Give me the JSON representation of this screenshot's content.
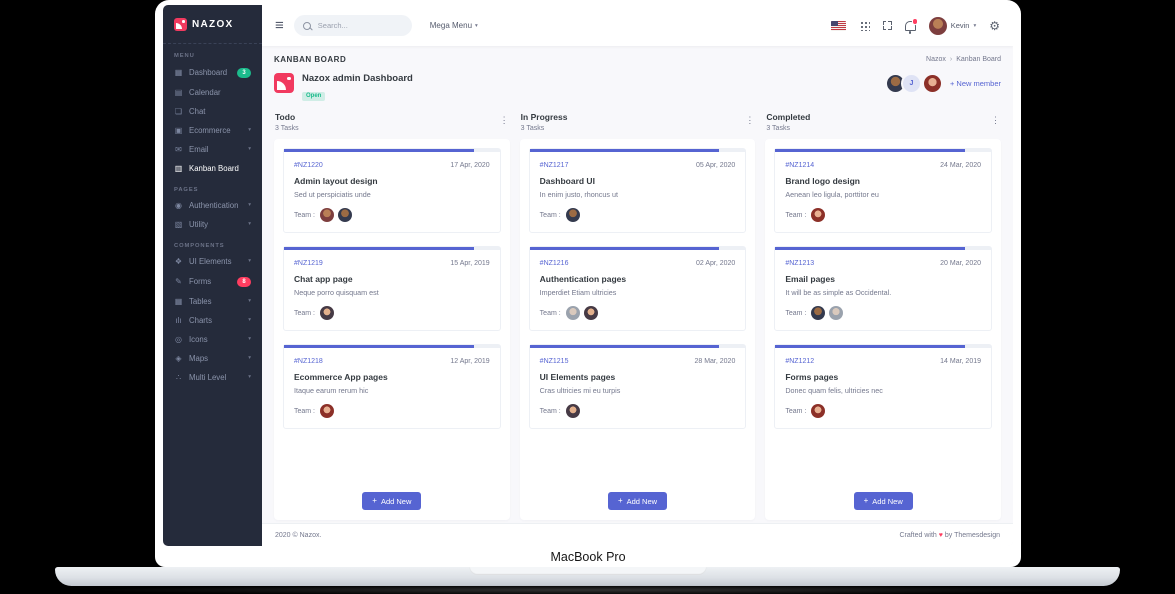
{
  "device": {
    "label": "MacBook Pro"
  },
  "brand": {
    "name": "NAZOX"
  },
  "colors": {
    "primary": "#5664d2",
    "success": "#1cbb8c",
    "danger": "#ff3d60",
    "sidebar_bg": "#252b3b",
    "body_bg": "#f8f8fb",
    "logo_red": "#f13a5f"
  },
  "topbar": {
    "search_placeholder": "Search...",
    "mega_menu_label": "Mega Menu",
    "user_name": "Kevin"
  },
  "sidebar": {
    "sections": [
      {
        "label": "MENU",
        "items": [
          {
            "label": "Dashboard",
            "badge": "3"
          },
          {
            "label": "Calendar"
          },
          {
            "label": "Chat"
          },
          {
            "label": "Ecommerce"
          },
          {
            "label": "Email"
          },
          {
            "label": "Kanban Board"
          }
        ]
      },
      {
        "label": "PAGES",
        "items": [
          {
            "label": "Authentication"
          },
          {
            "label": "Utility"
          }
        ]
      },
      {
        "label": "COMPONENTS",
        "items": [
          {
            "label": "UI Elements"
          },
          {
            "label": "Forms",
            "badge": "8"
          },
          {
            "label": "Tables"
          },
          {
            "label": "Charts"
          },
          {
            "label": "Icons"
          },
          {
            "label": "Maps"
          },
          {
            "label": "Multi Level"
          }
        ]
      }
    ]
  },
  "page": {
    "title": "KANBAN BOARD",
    "breadcrumb": [
      "Nazox",
      "Kanban Board"
    ],
    "board_title": "Nazox admin Dashboard",
    "board_status": "Open",
    "member_initial": "J",
    "header_members": [
      "av1"
    ],
    "header_members_right": [
      "av3"
    ],
    "new_member_label": "+ New member"
  },
  "board": {
    "team_label": "Team :",
    "columns": [
      {
        "name": "Todo",
        "tasks_label": "3 Tasks",
        "add_label": "Add New",
        "cards": [
          {
            "id": "#NZ1220",
            "date": "17 Apr, 2020",
            "title": "Admin layout design",
            "desc": "Sed ut perspiciatis unde",
            "team": [
              "av2",
              "av1"
            ]
          },
          {
            "id": "#NZ1219",
            "date": "15 Apr, 2019",
            "title": "Chat app page",
            "desc": "Neque porro quisquam est",
            "team": [
              "av4"
            ]
          },
          {
            "id": "#NZ1218",
            "date": "12 Apr, 2019",
            "title": "Ecommerce App pages",
            "desc": "Itaque earum rerum hic",
            "team": [
              "av3"
            ]
          }
        ]
      },
      {
        "name": "In Progress",
        "tasks_label": "3 Tasks",
        "add_label": "Add New",
        "cards": [
          {
            "id": "#NZ1217",
            "date": "05 Apr, 2020",
            "title": "Dashboard UI",
            "desc": "In enim justo, rhoncus ut",
            "team": [
              "av1"
            ]
          },
          {
            "id": "#NZ1216",
            "date": "02 Apr, 2020",
            "title": "Authentication pages",
            "desc": "Imperdiet Etiam ultricies",
            "team": [
              "av5",
              "av4"
            ]
          },
          {
            "id": "#NZ1215",
            "date": "28 Mar, 2020",
            "title": "UI Elements pages",
            "desc": "Cras ultricies mi eu turpis",
            "team": [
              "av4"
            ]
          }
        ]
      },
      {
        "name": "Completed",
        "tasks_label": "3 Tasks",
        "add_label": "Add New",
        "cards": [
          {
            "id": "#NZ1214",
            "date": "24 Mar, 2020",
            "title": "Brand logo design",
            "desc": "Aenean leo ligula, porttitor eu",
            "team": [
              "av3"
            ]
          },
          {
            "id": "#NZ1213",
            "date": "20 Mar, 2020",
            "title": "Email pages",
            "desc": "It will be as simple as Occidental.",
            "team": [
              "av1",
              "av5"
            ]
          },
          {
            "id": "#NZ1212",
            "date": "14 Mar, 2019",
            "title": "Forms pages",
            "desc": "Donec quam felis, ultricies nec",
            "team": [
              "av3"
            ]
          }
        ]
      }
    ]
  },
  "footer": {
    "left": "2020 © Nazox.",
    "right_prefix": "Crafted with",
    "heart": "♥",
    "right_suffix": "by Themesdesign"
  },
  "icons": {
    "hamburger": "≡",
    "caret": "▾",
    "kebab": "⋮",
    "crumb_sep": "›",
    "plus": "+",
    "gear": "⚙",
    "dashboard": "▦",
    "calendar": "▤",
    "chat": "❏",
    "ecommerce": "▣",
    "email": "✉",
    "kanban": "▥",
    "authentication": "◉",
    "utility": "▧",
    "ui_elements": "❖",
    "forms": "✎",
    "tables": "▦",
    "charts": "ılı",
    "icons": "◎",
    "maps": "◈",
    "multi_level": "∴"
  }
}
